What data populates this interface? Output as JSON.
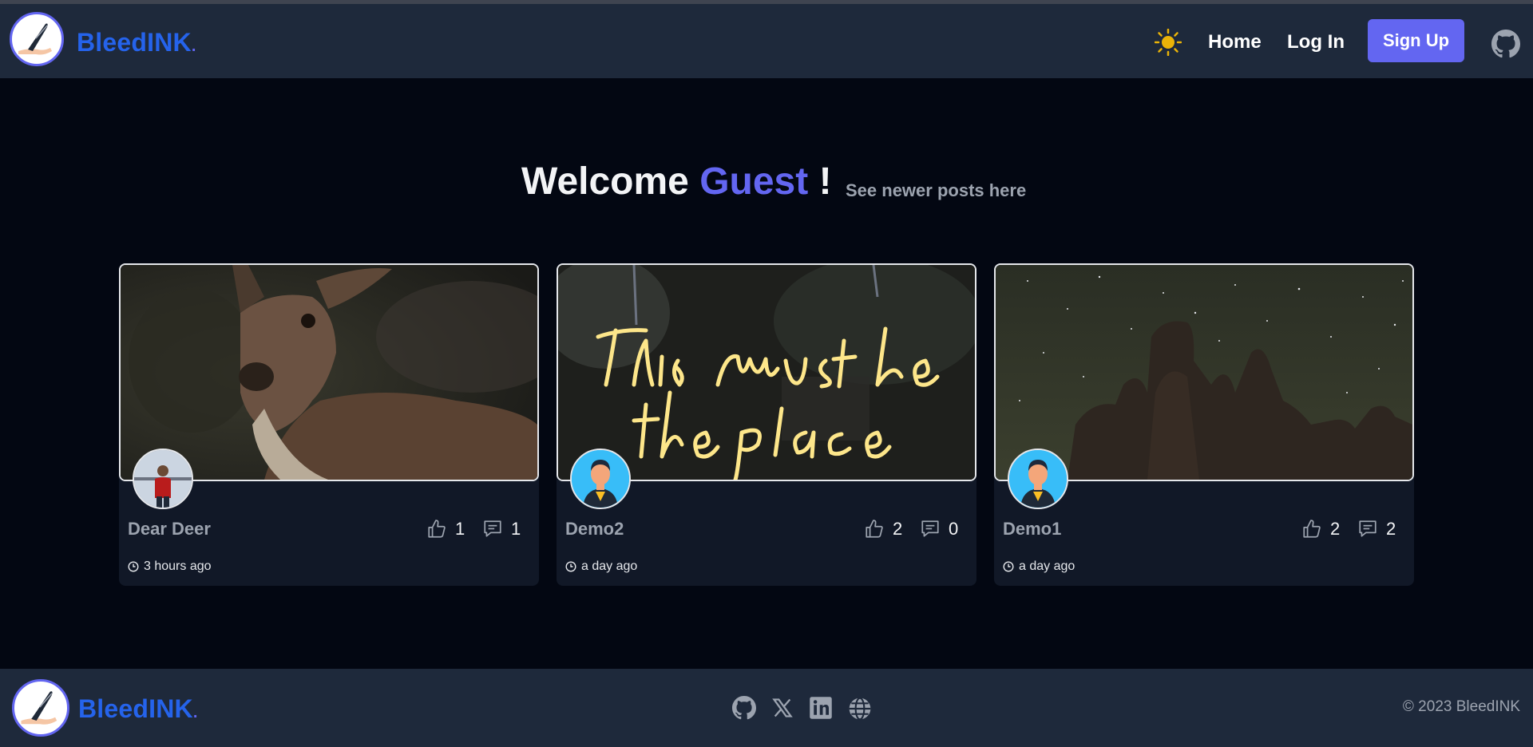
{
  "header": {
    "brand": "BleedINK",
    "brand_dot": ".",
    "nav": {
      "home": "Home",
      "login": "Log In",
      "signup": "Sign Up"
    }
  },
  "welcome": {
    "prefix": "Welcome",
    "name": "Guest",
    "suffix": "!",
    "newer_link": "See newer posts here"
  },
  "posts": [
    {
      "title": "Dear Deer",
      "likes": "1",
      "comments": "1",
      "time": "3 hours ago",
      "image": "deer-photo"
    },
    {
      "title": "Demo2",
      "likes": "2",
      "comments": "0",
      "time": "a day ago",
      "image": "neon-sign-photo"
    },
    {
      "title": "Demo1",
      "likes": "2",
      "comments": "2",
      "time": "a day ago",
      "image": "night-sky-rocks-photo"
    }
  ],
  "footer": {
    "brand": "BleedINK",
    "brand_dot": ".",
    "copyright": "© 2023 BleedINK",
    "social_icons": [
      "github-icon",
      "x-icon",
      "linkedin-icon",
      "globe-icon"
    ]
  },
  "colors": {
    "accent": "#6366f1",
    "brand": "#2563eb",
    "background": "#030712",
    "surface": "#1e293b",
    "sun": "#eab308"
  }
}
